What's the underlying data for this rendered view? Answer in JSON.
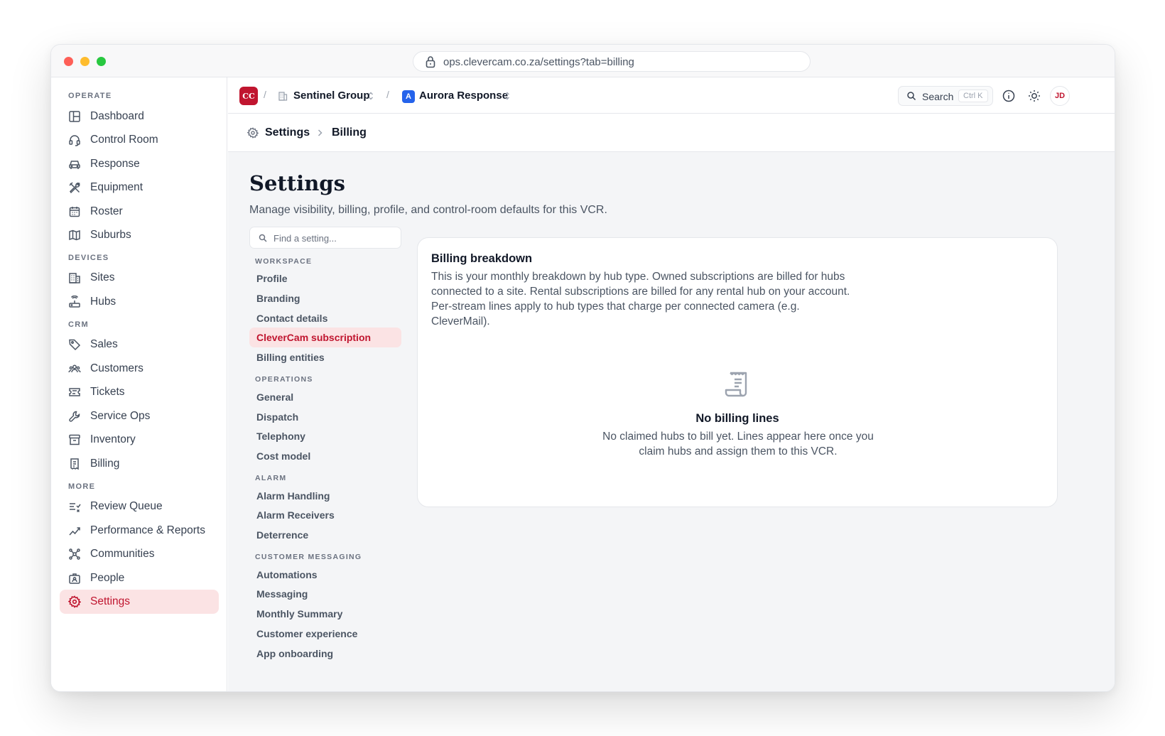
{
  "browser": {
    "url": "ops.clevercam.co.za/settings?tab=billing"
  },
  "sidebar": {
    "sections": [
      {
        "title": "OPERATE",
        "items": [
          {
            "label": "Dashboard",
            "icon": "dashboard-icon"
          },
          {
            "label": "Control Room",
            "icon": "headset-icon"
          },
          {
            "label": "Response",
            "icon": "car-icon"
          },
          {
            "label": "Equipment",
            "icon": "tools-icon"
          },
          {
            "label": "Roster",
            "icon": "calendar-icon"
          },
          {
            "label": "Suburbs",
            "icon": "map-icon"
          }
        ]
      },
      {
        "title": "DEVICES",
        "items": [
          {
            "label": "Sites",
            "icon": "building-icon"
          },
          {
            "label": "Hubs",
            "icon": "router-icon"
          }
        ]
      },
      {
        "title": "CRM",
        "items": [
          {
            "label": "Sales",
            "icon": "tag-icon"
          },
          {
            "label": "Customers",
            "icon": "users-icon"
          },
          {
            "label": "Tickets",
            "icon": "ticket-icon"
          },
          {
            "label": "Service Ops",
            "icon": "wrench-icon"
          },
          {
            "label": "Inventory",
            "icon": "archive-icon"
          },
          {
            "label": "Billing",
            "icon": "receipt-icon"
          }
        ]
      },
      {
        "title": "MORE",
        "items": [
          {
            "label": "Review Queue",
            "icon": "list-check-icon"
          },
          {
            "label": "Performance & Reports",
            "icon": "chart-line-icon"
          },
          {
            "label": "Communities",
            "icon": "network-icon"
          },
          {
            "label": "People",
            "icon": "id-badge-icon"
          },
          {
            "label": "Settings",
            "icon": "gear-icon",
            "active": true
          }
        ]
      }
    ]
  },
  "topbar": {
    "org_logo": "CC",
    "org_name": "Sentinel Group",
    "vcr_badge": "A",
    "vcr_name": "Aurora Response",
    "search_label": "Search",
    "search_shortcut": "Ctrl K",
    "avatar_initials": "JD"
  },
  "breadcrumb": {
    "root": "Settings",
    "current": "Billing"
  },
  "page": {
    "title": "Settings",
    "subtitle": "Manage visibility, billing, profile, and control-room defaults for this VCR."
  },
  "settings_nav": {
    "search_placeholder": "Find a setting...",
    "sections": [
      {
        "title": "WORKSPACE",
        "items": [
          "Profile",
          "Branding",
          "Contact details",
          "CleverCam subscription",
          "Billing entities"
        ]
      },
      {
        "title": "OPERATIONS",
        "items": [
          "General",
          "Dispatch",
          "Telephony",
          "Cost model"
        ]
      },
      {
        "title": "ALARM",
        "items": [
          "Alarm Handling",
          "Alarm Receivers",
          "Deterrence"
        ]
      },
      {
        "title": "CUSTOMER MESSAGING",
        "items": [
          "Automations",
          "Messaging",
          "Monthly Summary",
          "Customer experience",
          "App onboarding"
        ]
      }
    ],
    "active_item": "CleverCam subscription"
  },
  "billing_card": {
    "title": "Billing breakdown",
    "description": "This is your monthly breakdown by hub type. Owned subscriptions are billed for hubs connected to a site. Rental subscriptions are billed for any rental hub on your account. Per-stream lines apply to hub types that charge per connected camera (e.g. CleverMail).",
    "empty_icon": "receipt-icon",
    "empty_title": "No billing lines",
    "empty_description": "No claimed hubs to bill yet. Lines appear here once you claim hubs and assign them to this VCR."
  },
  "colors": {
    "accent": "#c0152f",
    "accent_bg": "#fbe3e4",
    "vcr_badge": "#2563eb"
  }
}
